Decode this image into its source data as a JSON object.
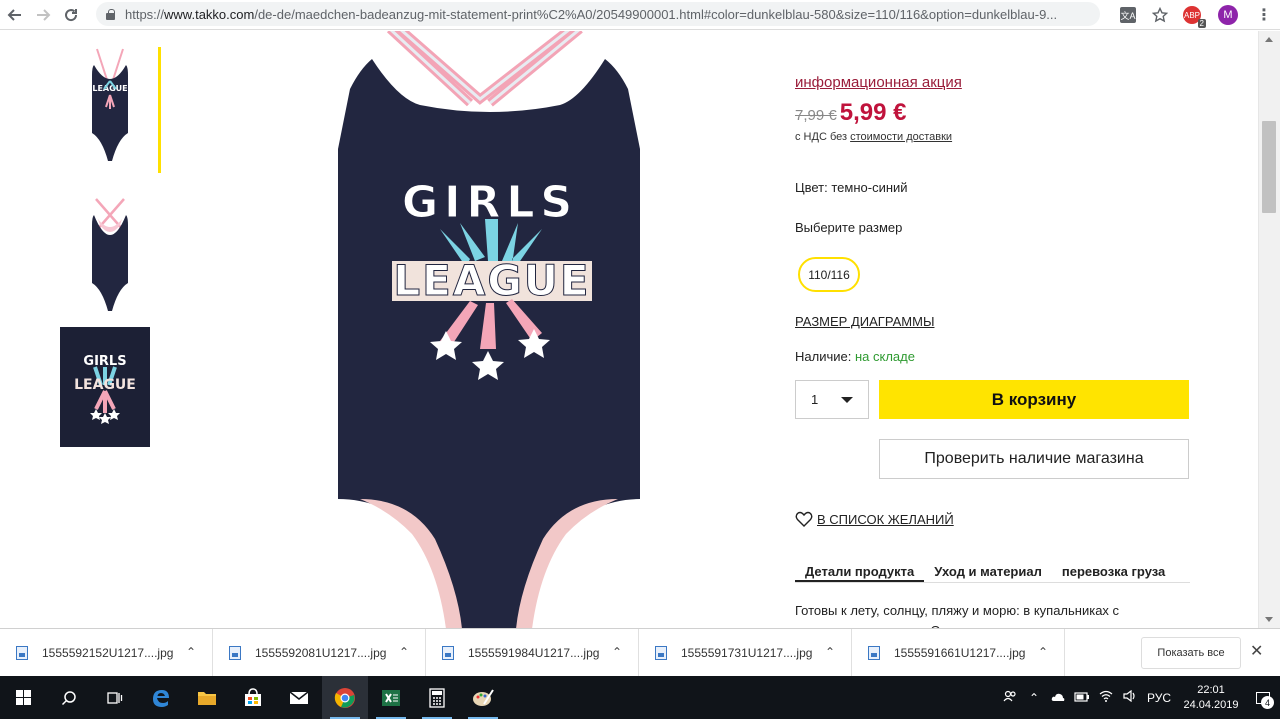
{
  "browser": {
    "url_prefix": "https://",
    "url_host": "www.takko.com",
    "url_path": "/de-de/maedchen-badeanzug-mit-statement-print%C2%A0/20549900001.html#color=dunkelblau-580&size=110/116&option=dunkelblau-9...",
    "avatar_letter": "M",
    "extension_label": "ABP",
    "extension_badge": "2",
    "translate_label": "文A"
  },
  "product": {
    "print_text_line1": "GIRLS",
    "print_text_line2": "LEAGUE",
    "promo_link": "информационная акция",
    "old_price": "7,99 €",
    "new_price": "5,99 €",
    "vat_prefix": "с НДС без ",
    "vat_link": "стоимости доставки",
    "color_line": "Цвет: темно-синий",
    "size_prompt": "Выберите размер",
    "size_options": [
      "110/116"
    ],
    "size_chart_link": "РАЗМЕР ДИАГРАММЫ",
    "availability_label": "Наличие: ",
    "availability_value": "на складе",
    "quantity": "1",
    "add_to_cart": "В корзину",
    "check_store": "Проверить наличие магазина",
    "wishlist": "В СПИСОК ЖЕЛАНИЙ",
    "tabs": [
      "Детали продукта",
      "Уход и материал",
      "перевозка груза"
    ],
    "description": "Готовы к лету, солнцу, пляжу и морю: в купальниках с интересным принтом. Он изготовлен из эластичного"
  },
  "downloads": {
    "items": [
      "1555592152U1217....jpg",
      "1555592081U1217....jpg",
      "1555591984U1217....jpg",
      "1555591731U1217....jpg",
      "1555591661U1217....jpg"
    ],
    "show_all": "Показать все"
  },
  "taskbar": {
    "lang": "РУС",
    "time": "22:01",
    "date": "24.04.2019",
    "notifications": "4"
  },
  "colors": {
    "accent_yellow": "#ffe400",
    "price_red": "#c0133c",
    "promo_link": "#9a1d3a",
    "in_stock_green": "#2e9a30",
    "swimsuit_navy": "#222640"
  }
}
